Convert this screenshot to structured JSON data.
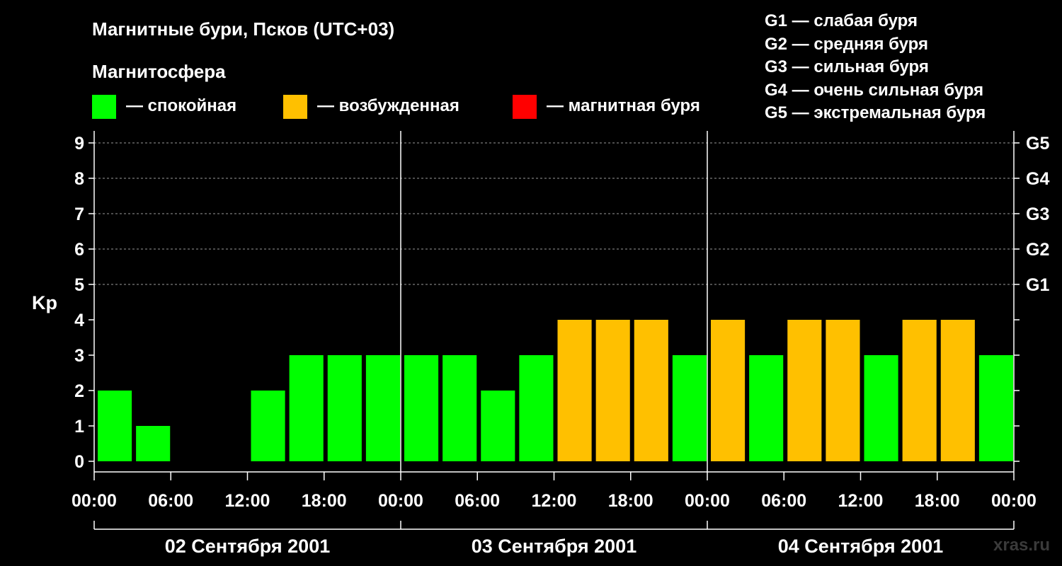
{
  "title": "Магнитные бури, Псков (UTC+03)",
  "subtitle": "Магнитосфера",
  "legend": [
    {
      "label": "— спокойная",
      "color": "#00ff00"
    },
    {
      "label": "— возбужденная",
      "color": "#ffc000"
    },
    {
      "label": "— магнитная буря",
      "color": "#ff0000"
    }
  ],
  "g_levels": [
    "G1 — слабая буря",
    "G2 — средняя буря",
    "G3 — сильная буря",
    "G4 — очень сильная буря",
    "G5 — экстремальная буря"
  ],
  "watermark": "xras.ru",
  "chart_data": {
    "type": "bar",
    "ylabel": "Kp",
    "ylim": [
      0,
      9
    ],
    "yticks": [
      "0",
      "1",
      "2",
      "3",
      "4",
      "5",
      "6",
      "7",
      "8",
      "9"
    ],
    "right_ticks": [
      {
        "kp": 5,
        "label": "G1"
      },
      {
        "kp": 6,
        "label": "G2"
      },
      {
        "kp": 7,
        "label": "G3"
      },
      {
        "kp": 8,
        "label": "G4"
      },
      {
        "kp": 9,
        "label": "G5"
      }
    ],
    "xticks": [
      "00:00",
      "06:00",
      "12:00",
      "18:00",
      "00:00",
      "06:00",
      "12:00",
      "18:00",
      "00:00",
      "06:00",
      "12:00",
      "18:00",
      "00:00"
    ],
    "days": [
      "02 Сентября 2001",
      "03 Сентября 2001",
      "04 Сентября 2001"
    ],
    "interval_hours": 3,
    "values": [
      2,
      1,
      0,
      0,
      2,
      3,
      3,
      3,
      3,
      3,
      2,
      3,
      4,
      4,
      4,
      3,
      4,
      3,
      4,
      4,
      3,
      4,
      4,
      3
    ],
    "grid": "dashed horizontal at integer Kp from 5 to 9",
    "colors": {
      "quiet": "#00ff00",
      "active": "#ffc000",
      "storm": "#ff0000"
    }
  }
}
